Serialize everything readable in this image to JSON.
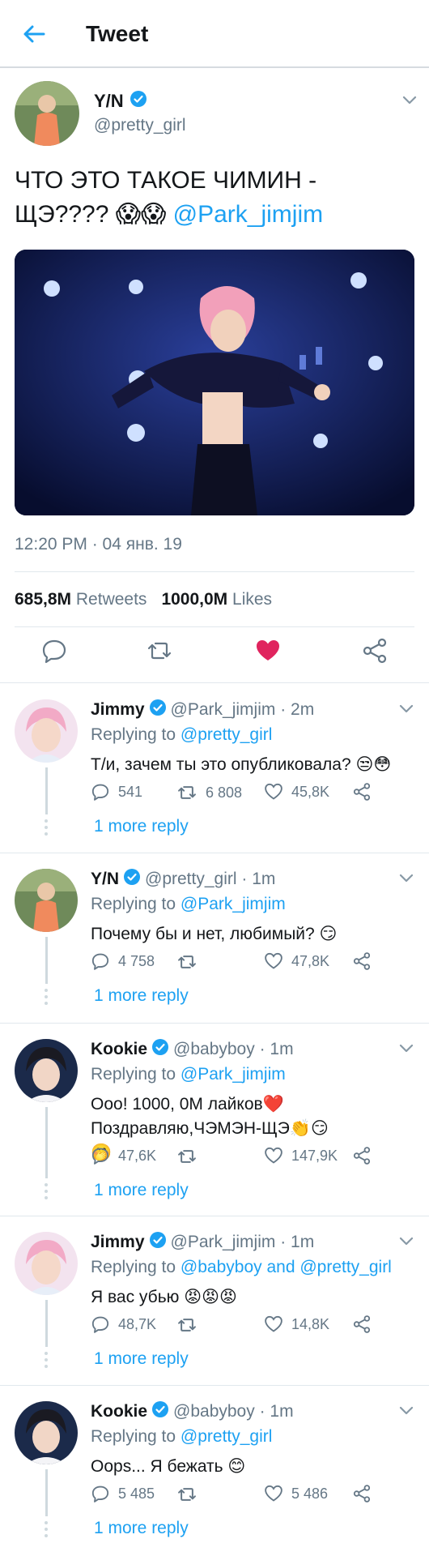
{
  "header": {
    "title": "Tweet",
    "back_icon": "arrow-left-icon"
  },
  "colors": {
    "accent": "#1da1f2",
    "like": "#e0245e",
    "text": "#14171a",
    "muted": "#657786"
  },
  "main_tweet": {
    "name": "Y/N",
    "handle": "@pretty_girl",
    "text": "ЧТО ЭТО ТАКОЕ ЧИМИН - ЩЭ???? 😱😱",
    "mention": "@Park_jimjim",
    "timestamp": "12:20 PM · 04 янв. 19",
    "retweets_count": "685,8M",
    "retweets_label": "Retweets",
    "likes_count": "1000,0M",
    "likes_label": "Likes"
  },
  "replies": [
    {
      "name": "Jimmy",
      "handle_time": "@Park_jimjim · 2m",
      "replying_label": "Replying to",
      "replying_to": "@pretty_girl",
      "text": "Т/и, зачем ты это опубликовала? 😒😳",
      "replies": "541",
      "retweets": "6 808",
      "likes": "45,8K",
      "more": "1 more reply"
    },
    {
      "name": "Y/N",
      "handle_time": "@pretty_girl · 1m",
      "replying_label": "Replying to",
      "replying_to": "@Park_jimjim",
      "text": "Почему бы и нет, любимый? 😏",
      "replies": "4 758",
      "retweets": "",
      "likes": "47,8K",
      "more": "1 more reply"
    },
    {
      "name": "Kookie",
      "handle_time": "@babyboy · 1m",
      "replying_label": "Replying to",
      "replying_to": "@Park_jimjim",
      "text": "Ооо! 1000, 0М лайков❤️ Поздравляю,ЧЭМЭН-ЩЭ👏😏🤭",
      "replies": "47,6K",
      "retweets": "",
      "likes": "147,9K",
      "more": "1 more reply"
    },
    {
      "name": "Jimmy",
      "handle_time": "@Park_jimjim · 1m",
      "replying_label": "Replying to",
      "replying_to": "@babyboy and @pretty_girl",
      "text": "Я вас убью 😡😡😡",
      "replies": "48,7K",
      "retweets": "",
      "likes": "14,8K",
      "more": "1 more reply"
    },
    {
      "name": "Kookie",
      "handle_time": "@babyboy · 1m",
      "replying_label": "Replying to",
      "replying_to": "@pretty_girl",
      "text": "Oops... Я бежать 😊",
      "replies": "5 485",
      "retweets": "",
      "likes": "5 486",
      "more": "1 more reply"
    }
  ]
}
